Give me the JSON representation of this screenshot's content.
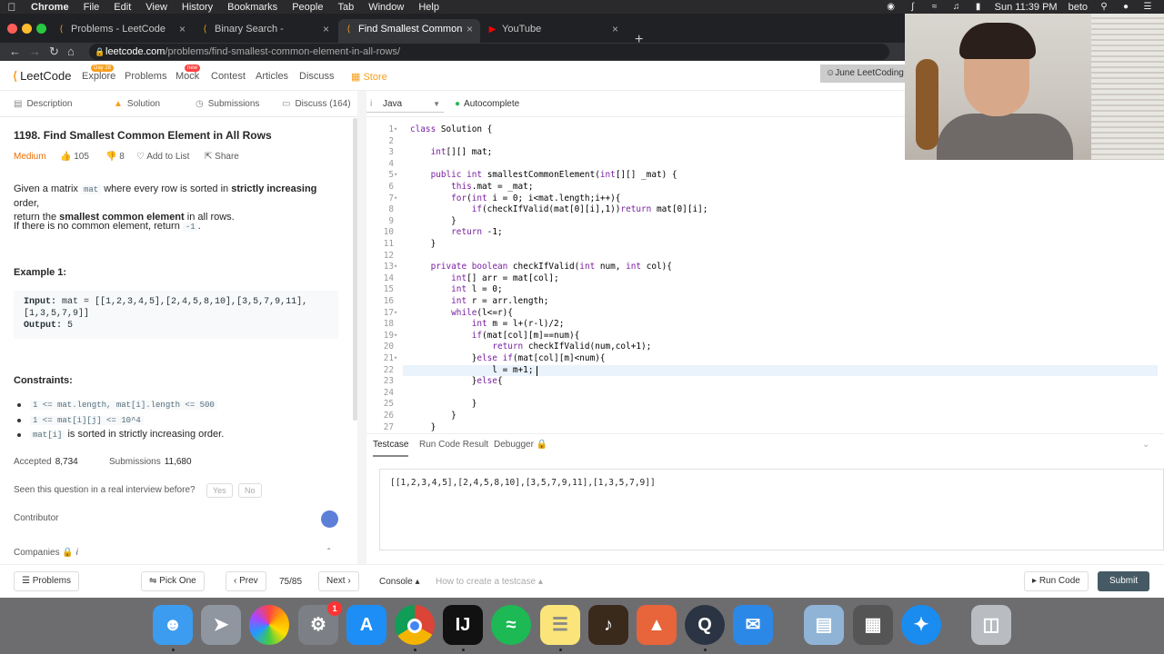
{
  "menubar": {
    "app": "Chrome",
    "items": [
      "File",
      "Edit",
      "View",
      "History",
      "Bookmarks",
      "People",
      "Tab",
      "Window",
      "Help"
    ],
    "clock": "Sun 11:39 PM",
    "user": "beto"
  },
  "tabs": [
    {
      "title": "Problems - LeetCode",
      "favicon": "leetcode-icon",
      "active": false
    },
    {
      "title": "Binary Search - LeetCode",
      "favicon": "leetcode-icon",
      "active": false
    },
    {
      "title": "Find Smallest Common Elemen",
      "favicon": "leetcode-icon",
      "active": true
    },
    {
      "title": "YouTube",
      "favicon": "youtube-icon",
      "active": false
    }
  ],
  "address": {
    "domain": "leetcode.com",
    "path": "/problems/find-smallest-common-element-in-all-rows/"
  },
  "nav": {
    "logo": "LeetCode",
    "links": [
      "Explore",
      "Problems",
      "Mock",
      "Contest",
      "Articles",
      "Discuss",
      "Store"
    ],
    "explore_badge": "Day 28",
    "mock_badge": "new",
    "promo": "June LeetCoding"
  },
  "left": {
    "tabs": [
      "Description",
      "Solution",
      "Submissions",
      "Discuss (164)"
    ],
    "title": "1198. Find Smallest Common Element in All Rows",
    "difficulty": "Medium",
    "likes": "105",
    "dislikes": "8",
    "add_to_list": "Add to List",
    "share": "Share",
    "desc1_a": "Given a matrix ",
    "desc1_code": "mat",
    "desc1_b": " where every row is sorted in ",
    "desc1_bold": "strictly increasing",
    "desc1_c": " order,",
    "desc2_a": "return the ",
    "desc2_bold": "smallest common element",
    "desc2_b": " in all rows.",
    "desc3_a": "If there is no common element, return ",
    "desc3_code": "-1",
    "desc3_b": ".",
    "example_heading": "Example 1:",
    "example_input_label": "Input:",
    "example_input": "mat = [[1,2,3,4,5],[2,4,5,8,10],[3,5,7,9,11],",
    "example_input2": "[1,3,5,7,9]]",
    "example_output_label": "Output:",
    "example_output": "5",
    "constraints_heading": "Constraints:",
    "c1": "1 <= mat.length, mat[i].length <= 500",
    "c2": "1 <= mat[i][j] <= 10^4",
    "c3_code": "mat[i]",
    "c3_text": "is sorted in strictly increasing order.",
    "accepted_label": "Accepted",
    "accepted": "8,734",
    "submissions_label": "Submissions",
    "submissions": "11,680",
    "seen_q": "Seen this question in a real interview before?",
    "yes": "Yes",
    "no": "No",
    "contributor": "Contributor",
    "companies": "Companies",
    "companies_info": "i"
  },
  "editor": {
    "language": "Java",
    "autocomplete": "Autocomplete",
    "lines": [
      "class Solution {",
      "",
      "    int[][] mat;",
      "",
      "    public int smallestCommonElement(int[][] _mat) {",
      "        this.mat = _mat;",
      "        for(int i = 0; i<mat.length;i++){",
      "            if(checkIfValid(mat[0][i],1))return mat[0][i];",
      "        }",
      "        return -1;",
      "    }",
      "",
      "    private boolean checkIfValid(int num, int col){",
      "        int[] arr = mat[col];",
      "        int l = 0;",
      "        int r = arr.length;",
      "        while(l<=r){",
      "            int m = l+(r-l)/2;",
      "            if(mat[col][m]==num){",
      "                return checkIfValid(num,col+1);",
      "            }else if(mat[col][m]<num){",
      "                l = m+1;",
      "            }else{",
      "",
      "            }",
      "        }",
      "    }"
    ],
    "line_numbers": [
      "1",
      "2",
      "3",
      "4",
      "5",
      "6",
      "7",
      "8",
      "9",
      "10",
      "11",
      "12",
      "13",
      "14",
      "15",
      "16",
      "17",
      "18",
      "19",
      "20",
      "21",
      "22",
      "23",
      "24",
      "25",
      "26",
      "27"
    ]
  },
  "console": {
    "tabs": [
      "Testcase",
      "Run Code Result",
      "Debugger"
    ],
    "testcase": "[[1,2,3,4,5],[2,4,5,8,10],[3,5,7,9,11],[1,3,5,7,9]]"
  },
  "bottom": {
    "problems": "Problems",
    "pick_one": "Pick One",
    "prev": "Prev",
    "page": "75/85",
    "next": "Next",
    "console": "Console",
    "how_to": "How to create a testcase",
    "run": "Run Code",
    "submit": "Submit"
  },
  "dock": {
    "apps": [
      "finder-icon",
      "launchpad-icon",
      "photos-icon",
      "system-preferences-icon",
      "app-store-icon",
      "chrome-icon",
      "intellij-icon",
      "spotify-icon",
      "notes-icon",
      "garageband-icon",
      "affinity-icon",
      "quicktime-icon",
      "mail-icon",
      "preview-icon",
      "calculator-icon",
      "safari-icon",
      "trash-icon"
    ],
    "settings_badge": "1"
  }
}
